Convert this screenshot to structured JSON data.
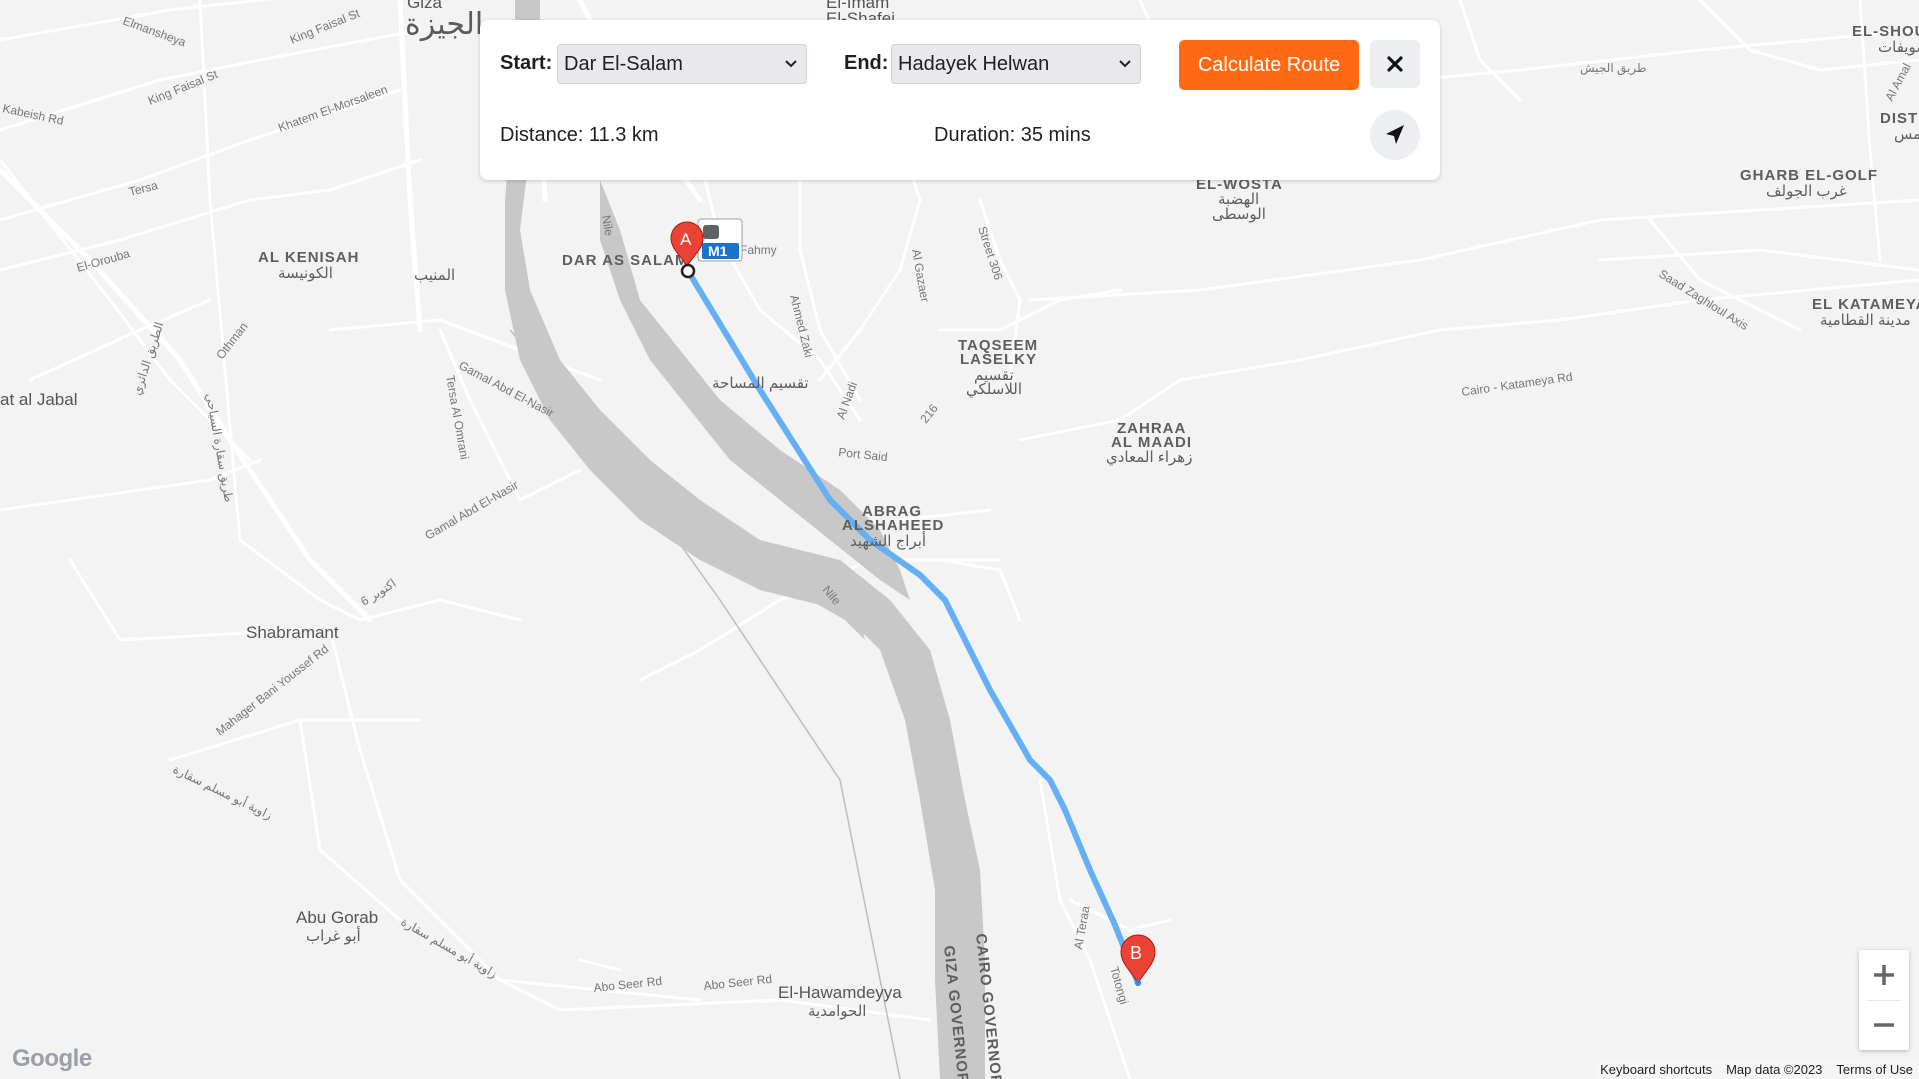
{
  "route_panel": {
    "start_label": "Start:",
    "start_value": "Dar El-Salam",
    "end_label": "End:",
    "end_value": "Hadayek Helwan",
    "calculate_label": "Calculate Route",
    "close_icon": "close-icon",
    "distance_text": "Distance: 11.3 km",
    "duration_text": "Duration: 35 mins",
    "locate_icon": "navigation-arrow-icon"
  },
  "markers": {
    "a_label": "A",
    "b_label": "B",
    "transit_badge": "M1"
  },
  "map_labels": {
    "giza_en": "Giza",
    "giza_ar": "الجيزة",
    "elmansheya": "Elmansheya",
    "king_faisal_1": "King Faisal St",
    "king_faisal_2": "King Faisal St",
    "kabeish": "Kabeish Rd",
    "el_morsaleen": "Khatem El-Morsaleen",
    "tersa": "Tersa",
    "el_orouba": "El-Orouba",
    "al_kenisah_en": "AL KENISAH",
    "al_kenisah_ar": "الكونيسة",
    "el_moneeb": "المنيب",
    "jabal": "at al Jabal",
    "dar_salam": "DAR AS SALAM",
    "imam_1": "El-Imam",
    "imam_2": "El-Shafei",
    "fahmy": "Fahmy",
    "nile_1": "Nile",
    "nile_2": "Nile",
    "al_gazaer": "Al Gazaer",
    "street_306": "Street 306",
    "ahmed_zaki": "Ahmed Zaki",
    "taqseem_en_1": "TAQSEEM",
    "taqseem_en_2": "LASELKY",
    "taqseem_ar_1": "تقسيم",
    "taqseem_ar_2": "اللاسلكي",
    "masaha_ar": "تقسيم المساحة",
    "al_nadi": "Al Nadi",
    "r216": "216",
    "port_said": "Port Said",
    "gamal_1": "Gamal Abd El-Nasir",
    "gamal_2": "Gamal Abd El-Nasir",
    "tersa_omrani": "Tersa Al Omrani",
    "othman": "Othman",
    "sa_ar_road": "الطريق الدائري",
    "saqqara_ar": "طريق سقارة السياحي",
    "oct6": "6 اكتوبر",
    "abrag_1": "ABRAG",
    "abrag_2": "ALSHAHEED",
    "abrag_ar": "أبراج الشهيد",
    "zahraa_1": "ZAHRAA",
    "zahraa_2": "AL MAADI",
    "zahraa_ar": "زهراء المعادي",
    "wosta_en": "EL-WOSTA",
    "wosta_ar_1": "الهضبة",
    "wosta_ar_2": "الوسطى",
    "gharb_en": "GHARB EL-GOLF",
    "gharb_ar": "غرب الجولف",
    "katameya_en": "EL KATAMEYA",
    "katameya_ar": "مدينة القطامية",
    "shoul": "EL-SHOUL",
    "shoul_ar": "سويفات",
    "dist": "DIST",
    "dist_ar": "مس",
    "tareeq_gaysh": "طريق الجيش",
    "cairo_katameya": "Cairo - Katameya Rd",
    "saad_zaghloul": "Saad Zaghloul Axis",
    "al_amal": "Al Amal",
    "shabramant": "Shabramant",
    "mahager": "Mahager Bani Youssef Rd",
    "abu_muslim_1": "زاوية أبو مسلم سقارة",
    "abu_muslim_2": "زاوية أبو مسلم سقارة",
    "abu_gorab_en": "Abu Gorab",
    "abu_gorab_ar": "أبو غراب",
    "abo_seer_1": "Abo Seer Rd",
    "abo_seer_2": "Abo Seer Rd",
    "hawamdeyya_en": "El-Hawamdeyya",
    "hawamdeyya_ar": "الحوامدية",
    "giza_gov": "GIZA GOVERNORATE",
    "cairo_gov": "CAIRO GOVERNORATE",
    "al_teraa": "Al Teraa",
    "totongi": "Totongi"
  },
  "zoom": {
    "in_icon": "plus-icon",
    "out_icon": "minus-icon"
  },
  "attribution": {
    "logo": "Google",
    "keyboard": "Keyboard shortcuts",
    "map_data": "Map data ©2023",
    "terms": "Terms of Use"
  },
  "colors": {
    "route": "#64b0f4",
    "marker": "#ea4335",
    "button": "#ff6a13",
    "river": "#c8c8c8",
    "transit": "#1a73c8"
  }
}
